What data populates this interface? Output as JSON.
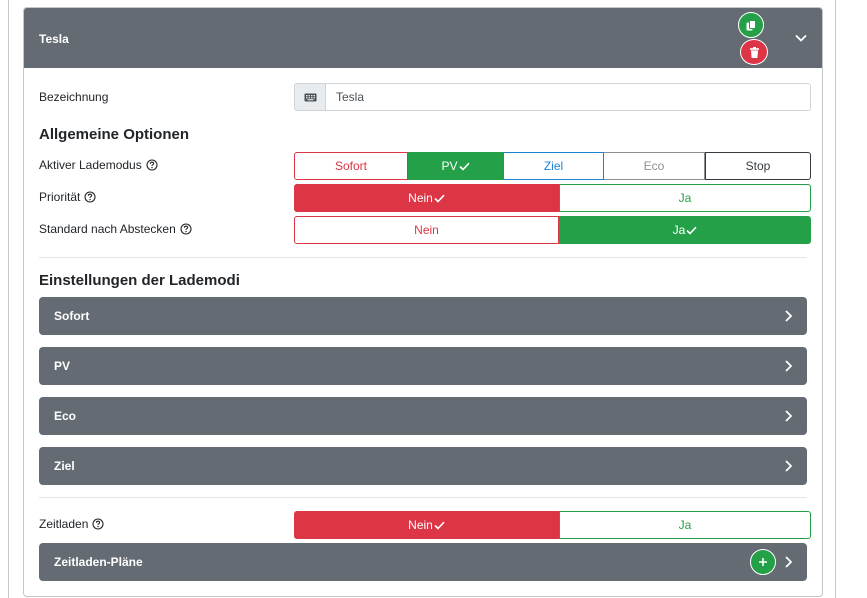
{
  "card": {
    "title": "Tesla"
  },
  "bezeichnung": {
    "label": "Bezeichnung",
    "value": "Tesla"
  },
  "general": {
    "section_title": "Allgemeine Optionen",
    "charge_mode": {
      "label": "Aktiver Lademodus",
      "options": [
        "Sofort",
        "PV",
        "Ziel",
        "Eco",
        "Stop"
      ],
      "selected": "PV"
    },
    "priority": {
      "label": "Priorität",
      "no": "Nein",
      "yes": "Ja",
      "selected": "Nein"
    },
    "default_after_unplug": {
      "label": "Standard nach Abstecken",
      "no": "Nein",
      "yes": "Ja",
      "selected": "Ja"
    }
  },
  "modes": {
    "section_title": "Einstellungen der Lademodi",
    "items": [
      "Sofort",
      "PV",
      "Eco",
      "Ziel"
    ]
  },
  "time_charging": {
    "label": "Zeitladen",
    "no": "Nein",
    "yes": "Ja",
    "selected": "Nein",
    "plans_label": "Zeitladen-Pläne"
  },
  "colors": {
    "header_bg": "#646b73",
    "danger": "#dc3545",
    "success": "#24a148",
    "info": "#1b84d4",
    "secondary": "#8a8f95",
    "dark": "#343a40"
  },
  "icons": [
    "copy-icon",
    "trash-icon",
    "chevron-down-icon",
    "keyboard-icon",
    "help-circle-icon",
    "check-icon",
    "chevron-right-icon",
    "plus-icon"
  ]
}
